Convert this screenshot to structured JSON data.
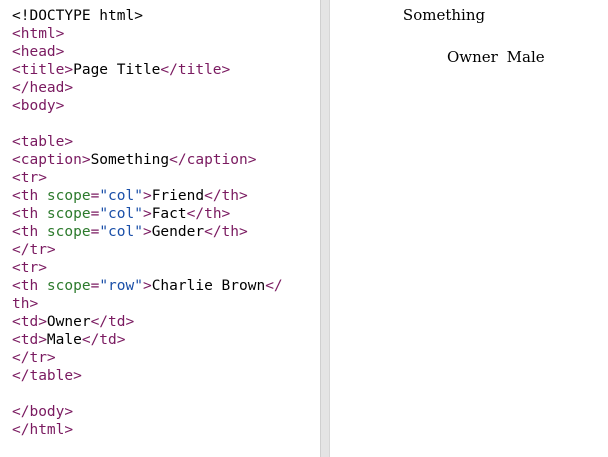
{
  "editor": {
    "lines": [
      [
        {
          "t": "p",
          "v": "<!DOCTYPE html>"
        }
      ],
      [
        {
          "t": "t",
          "v": "<html>"
        }
      ],
      [
        {
          "t": "t",
          "v": "<head>"
        }
      ],
      [
        {
          "t": "t",
          "v": "<title>"
        },
        {
          "t": "p",
          "v": "Page Title"
        },
        {
          "t": "t",
          "v": "</title>"
        }
      ],
      [
        {
          "t": "t",
          "v": "</head>"
        }
      ],
      [
        {
          "t": "t",
          "v": "<body>"
        }
      ],
      [],
      [
        {
          "t": "t",
          "v": "<table>"
        }
      ],
      [
        {
          "t": "t",
          "v": "<caption>"
        },
        {
          "t": "p",
          "v": "Something"
        },
        {
          "t": "t",
          "v": "</caption>"
        }
      ],
      [
        {
          "t": "t",
          "v": "<tr>"
        }
      ],
      [
        {
          "t": "t",
          "v": "<th "
        },
        {
          "t": "a",
          "v": "scope"
        },
        {
          "t": "t",
          "v": "="
        },
        {
          "t": "s",
          "v": "\"col\""
        },
        {
          "t": "t",
          "v": ">"
        },
        {
          "t": "p",
          "v": "Friend"
        },
        {
          "t": "t",
          "v": "</th>"
        }
      ],
      [
        {
          "t": "t",
          "v": "<th "
        },
        {
          "t": "a",
          "v": "scope"
        },
        {
          "t": "t",
          "v": "="
        },
        {
          "t": "s",
          "v": "\"col\""
        },
        {
          "t": "t",
          "v": ">"
        },
        {
          "t": "p",
          "v": "Fact"
        },
        {
          "t": "t",
          "v": "</th>"
        }
      ],
      [
        {
          "t": "t",
          "v": "<th "
        },
        {
          "t": "a",
          "v": "scope"
        },
        {
          "t": "t",
          "v": "="
        },
        {
          "t": "s",
          "v": "\"col\""
        },
        {
          "t": "t",
          "v": ">"
        },
        {
          "t": "p",
          "v": "Gender"
        },
        {
          "t": "t",
          "v": "</th>"
        }
      ],
      [
        {
          "t": "t",
          "v": "</tr>"
        }
      ],
      [
        {
          "t": "t",
          "v": "<tr>"
        }
      ],
      [
        {
          "t": "t",
          "v": "<th "
        },
        {
          "t": "a",
          "v": "scope"
        },
        {
          "t": "t",
          "v": "="
        },
        {
          "t": "s",
          "v": "\"row\""
        },
        {
          "t": "t",
          "v": ">"
        },
        {
          "t": "p",
          "v": "Charlie Brown"
        },
        {
          "t": "t",
          "v": "</"
        }
      ],
      [
        {
          "t": "t",
          "v": "th>"
        }
      ],
      [
        {
          "t": "t",
          "v": "<td>"
        },
        {
          "t": "p",
          "v": "Owner"
        },
        {
          "t": "t",
          "v": "</td>"
        }
      ],
      [
        {
          "t": "t",
          "v": "<td>"
        },
        {
          "t": "p",
          "v": "Male"
        },
        {
          "t": "t",
          "v": "</td>"
        }
      ],
      [
        {
          "t": "t",
          "v": "</tr>"
        }
      ],
      [
        {
          "t": "t",
          "v": "</table>"
        }
      ],
      [],
      [
        {
          "t": "t",
          "v": "</body>"
        }
      ],
      [
        {
          "t": "t",
          "v": "</html>"
        }
      ]
    ]
  },
  "preview": {
    "caption": "Something",
    "cells": [
      "Owner",
      "Male"
    ]
  },
  "colors": {
    "tag": "#7a1a60",
    "attribute": "#2c7a2c",
    "value": "#1a4fa8",
    "text": "#000000",
    "divider": "#e4e4e4"
  }
}
